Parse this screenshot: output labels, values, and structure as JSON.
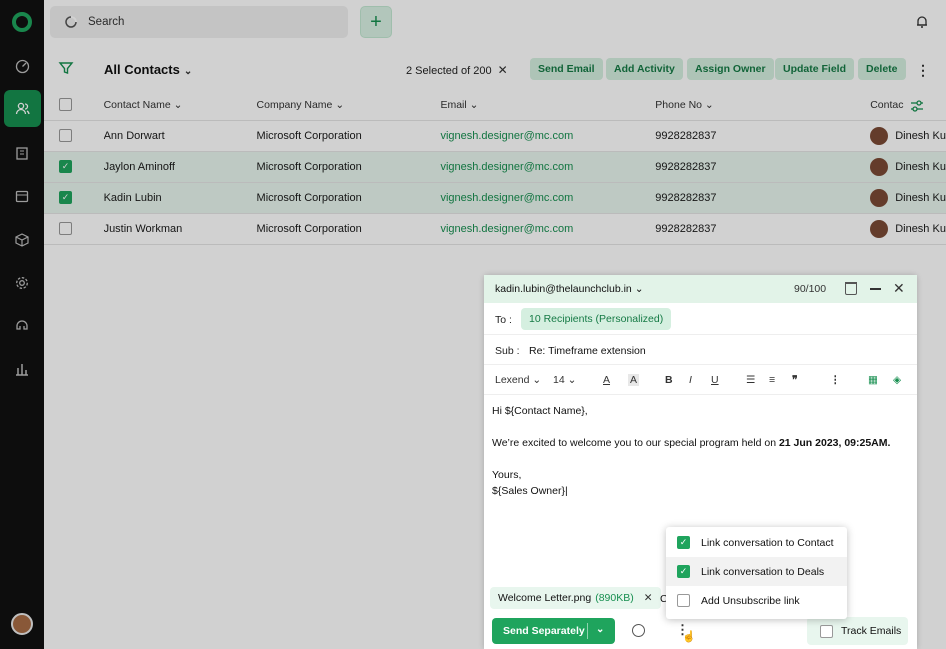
{
  "topbar": {
    "search_placeholder": "Search",
    "add_label": "+"
  },
  "toolbar": {
    "view_title": "All Contacts",
    "selection_info": "2 Selected of 200",
    "buttons": [
      "Send Email",
      "Add Activity",
      "Assign Owner",
      "Update Field",
      "Delete"
    ]
  },
  "table": {
    "columns": [
      "Contact Name",
      "Company Name",
      "Email",
      "Phone No",
      "Contac"
    ],
    "rows": [
      {
        "name": "Ann Dorwart",
        "company": "Microsoft Corporation",
        "email": "vignesh.designer@mc.com",
        "phone": "9928282837",
        "owner": "Dinesh Ku",
        "selected": false
      },
      {
        "name": "Jaylon Aminoff",
        "company": "Microsoft Corporation",
        "email": "vignesh.designer@mc.com",
        "phone": "9928282837",
        "owner": "Dinesh Ku",
        "selected": true
      },
      {
        "name": "Kadin Lubin",
        "company": "Microsoft Corporation",
        "email": "vignesh.designer@mc.com",
        "phone": "9928282837",
        "owner": "Dinesh Ku",
        "selected": true
      },
      {
        "name": "Justin Workman",
        "company": "Microsoft Corporation",
        "email": "vignesh.designer@mc.com",
        "phone": "9928282837",
        "owner": "Dinesh Ku",
        "selected": false
      }
    ]
  },
  "compose": {
    "from": "kadin.lubin@thelaunchclub.in",
    "count": "90/100",
    "to_label": "To :",
    "recipients": "10 Recipients (Personalized)",
    "sub_label": "Sub :",
    "subject": "Re: Timeframe extension",
    "font": "Lexend",
    "size": "14",
    "body_greeting": "Hi ${Contact Name},",
    "body_line_pre": "We’re excited to welcome you to our special program held on ",
    "body_line_bold": "21 Jun 2023, 09:25AM.",
    "body_sign1": "Yours,",
    "body_sign2": "${Sales Owner}",
    "attachment_name": "Welcome Letter.png",
    "attachment_size": "(890KB)",
    "attachment_more": "C",
    "send_label": "Send Separately",
    "track_label": "Track Emails"
  },
  "menu": {
    "items": [
      {
        "label": "Link conversation to Contact",
        "checked": true
      },
      {
        "label": "Link conversation to Deals",
        "checked": true
      },
      {
        "label": "Add Unsubscribe link",
        "checked": false
      }
    ]
  },
  "colors": {
    "accent": "#1fa45d",
    "accent_light": "#d5efe0",
    "sidebar": "#111111"
  }
}
